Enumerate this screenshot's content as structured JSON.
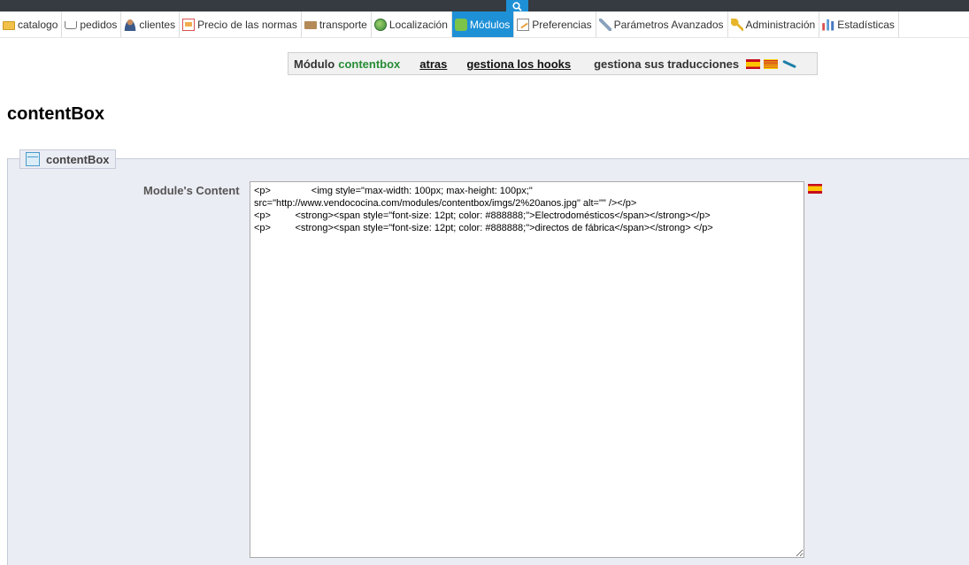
{
  "nav": {
    "tabs": [
      {
        "label": "catalogo",
        "icon": "folder-icon"
      },
      {
        "label": "pedidos",
        "icon": "cart-icon"
      },
      {
        "label": "clientes",
        "icon": "user-icon"
      },
      {
        "label": "Precio de las normas",
        "icon": "price-rules-icon"
      },
      {
        "label": "transporte",
        "icon": "truck-icon"
      },
      {
        "label": "Localización",
        "icon": "globe-icon"
      },
      {
        "label": "Módulos",
        "icon": "puzzle-icon",
        "active": true
      },
      {
        "label": "Preferencias",
        "icon": "preferences-icon"
      },
      {
        "label": "Parámetros Avanzados",
        "icon": "wrench-icon"
      },
      {
        "label": "Administración",
        "icon": "key-icon"
      },
      {
        "label": "Estadísticas",
        "icon": "stats-icon"
      }
    ],
    "accent": "#1e90d6"
  },
  "module_bar": {
    "prefix": "Módulo",
    "module_name": "contentbox",
    "back_label": "atras",
    "hooks_label": "gestiona los hooks",
    "translations_label": "gestiona sus traducciones"
  },
  "page": {
    "title": "contentBox"
  },
  "panel": {
    "legend": "contentBox",
    "field_label": "Module's Content",
    "content": "<p>               <img style=\"max-width: 100px; max-height: 100px;\"\nsrc=\"http://www.vendococina.com/modules/contentbox/imgs/2%20anos.jpg\" alt=\"\" /></p>\n<p>         <strong><span style=\"font-size: 12pt; color: #888888;\">Electrodomésticos</span></strong></p>\n<p>         <strong><span style=\"font-size: 12pt; color: #888888;\">directos de fábrica</span></strong> </p>"
  }
}
